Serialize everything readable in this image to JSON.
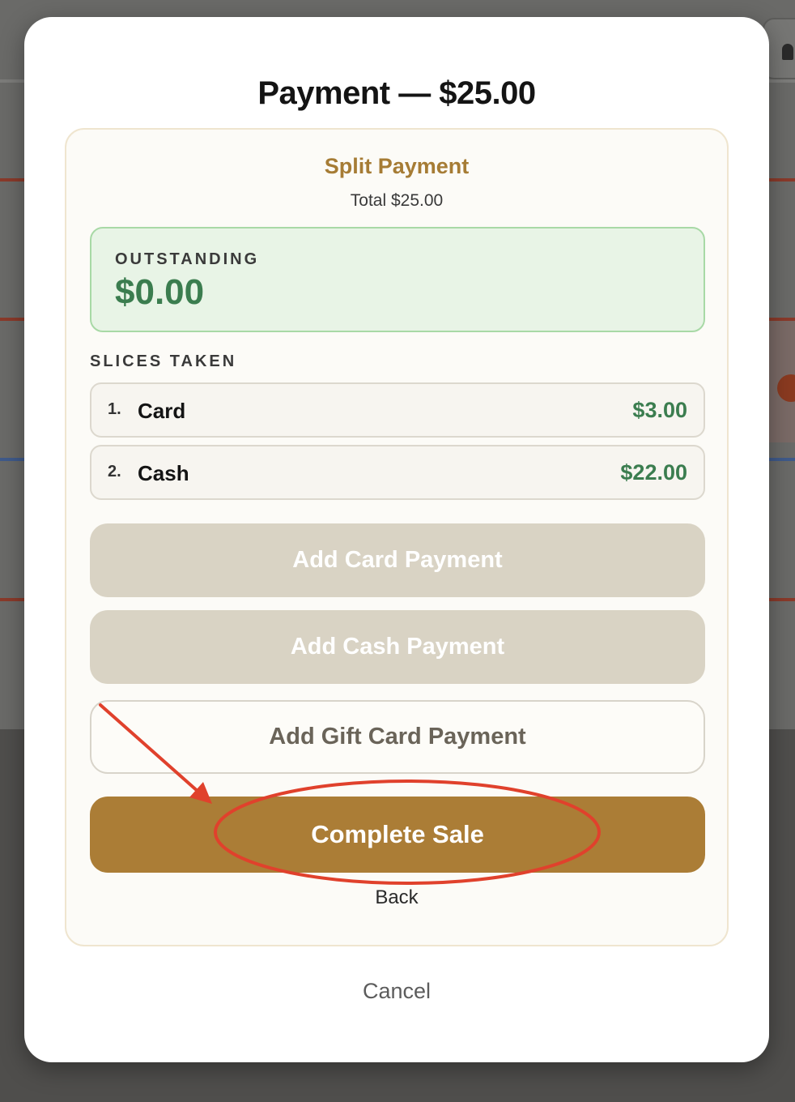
{
  "modal": {
    "title": "Payment — $25.00",
    "split": {
      "title": "Split Payment",
      "total": "Total $25.00",
      "outstanding_label": "OUTSTANDING",
      "outstanding_amount": "$0.00",
      "slices_label": "SLICES TAKEN",
      "slices": [
        {
          "index": "1.",
          "method": "Card",
          "amount": "$3.00"
        },
        {
          "index": "2.",
          "method": "Cash",
          "amount": "$22.00"
        }
      ],
      "add_card_label": "Add Card Payment",
      "add_cash_label": "Add Cash Payment",
      "add_gift_card_label": "Add Gift Card Payment",
      "complete_label": "Complete Sale",
      "back_label": "Back"
    },
    "cancel_label": "Cancel"
  },
  "colors": {
    "accent": "#ab7d36",
    "success": "#3b7d4f",
    "annotation": "#e0412c"
  },
  "annotation": {
    "shapes": [
      "arrow",
      "ellipse"
    ],
    "highlights": "complete-sale-button"
  }
}
